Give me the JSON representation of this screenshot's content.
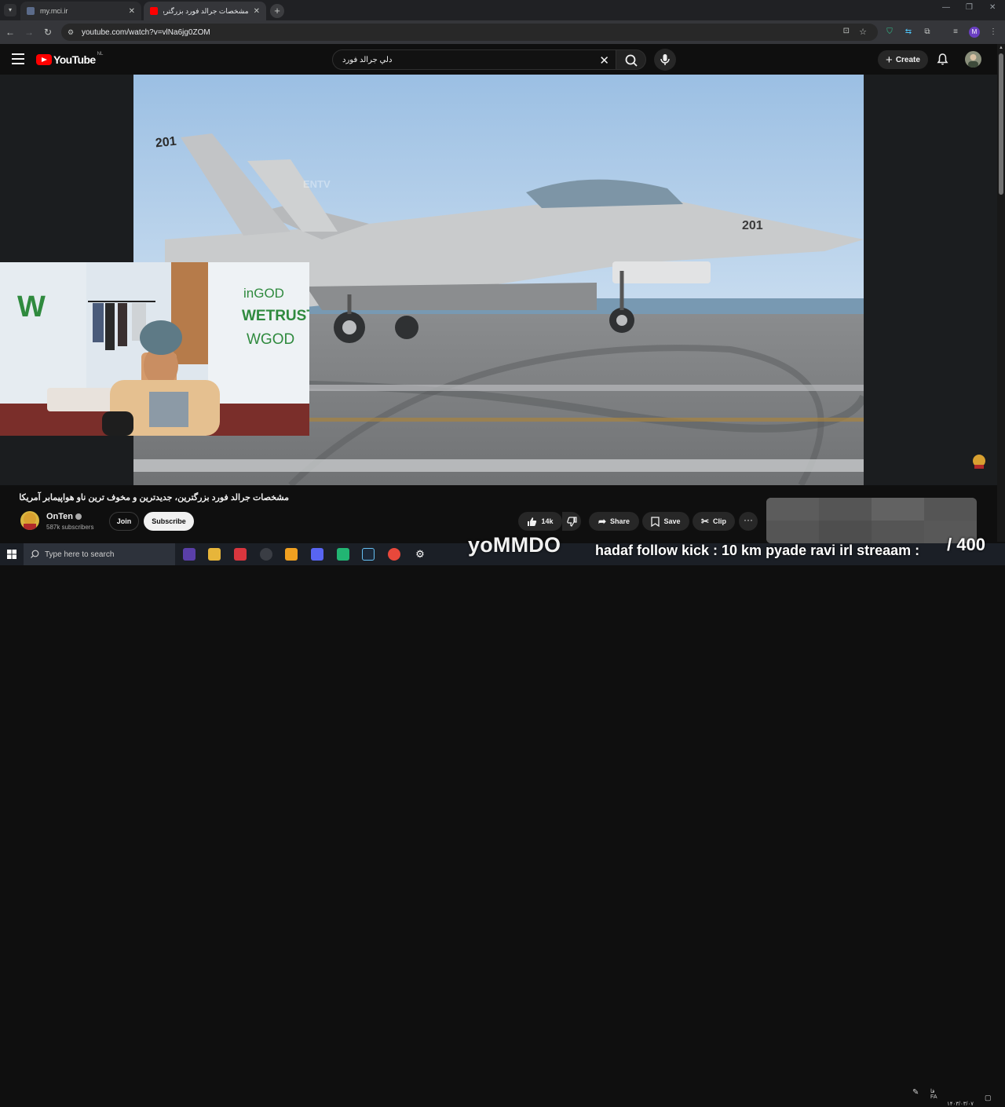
{
  "browser": {
    "tabs": [
      {
        "title": "my.mci.ir",
        "active": false
      },
      {
        "title": "مشخصات جرالد فورد بزرگترین، جد",
        "active": true
      }
    ],
    "new_tab": "+",
    "url": "youtube.com/watch?v=vlNa6jg0ZOM"
  },
  "youtube": {
    "logo_text": "YouTube",
    "country_code": "NL",
    "search_value": "دلي جرالد فورد",
    "create_label": "Create"
  },
  "video": {
    "title": "مشخصات جرالد فورد بزرگترین، جدیدترین و مخوف ترین ناو هواپیمابر آمریکا",
    "watermark": "ENTV",
    "jet_number": "201",
    "webcam_wall_text_1": "inGOD",
    "webcam_wall_text_2": "WETRUST",
    "webcam_wall_text_3": "WGOD",
    "webcam_wall_letter": "W"
  },
  "channel": {
    "name": "OnTen",
    "subscribers": "587k subscribers",
    "join_label": "Join",
    "subscribe_label": "Subscribe"
  },
  "actions": {
    "likes": "14k",
    "share_label": "Share",
    "save_label": "Save",
    "clip_label": "Clip"
  },
  "taskbar": {
    "search_placeholder": "Type here to search",
    "lang": "FA",
    "lang2": "فا",
    "date": "۱۴۰۳/۰۳/۰۷"
  },
  "stream_overlay": {
    "name": "yoMMDO",
    "ticker": "hadaf follow kick : 10 km pyade ravi irl streaam :",
    "counter": "/ 400"
  },
  "colors": {
    "yt_red": "#ff0000",
    "bg": "#0f0f0f",
    "chrome_bar": "#35363a"
  }
}
